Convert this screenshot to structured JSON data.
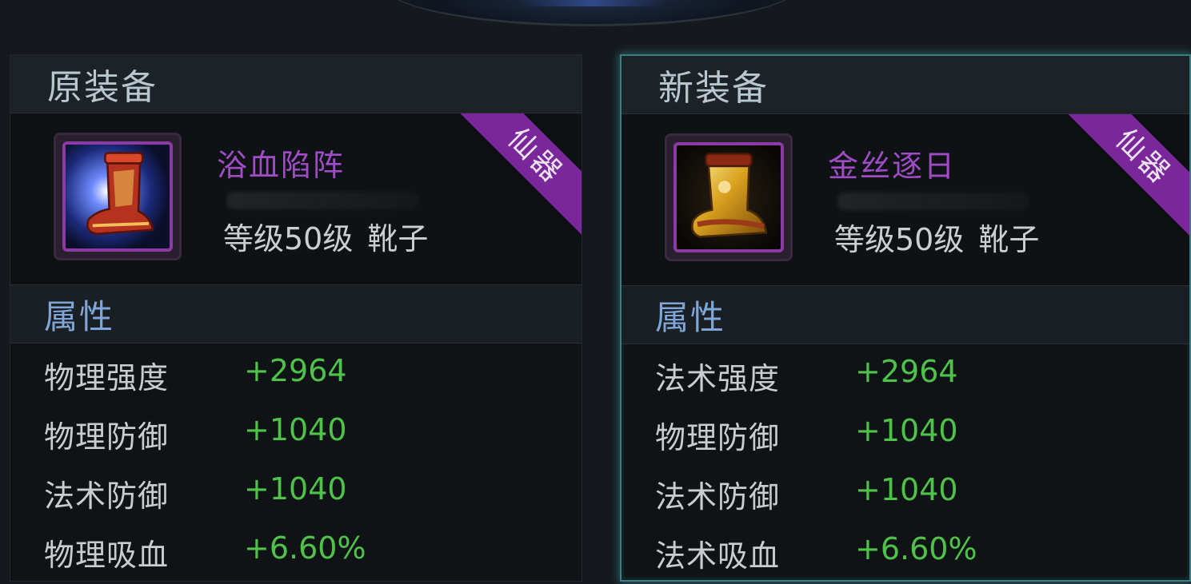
{
  "panels": {
    "old": {
      "title": "原装备",
      "item": {
        "name": "浴血陷阵",
        "level": "等级50级",
        "slot": "靴子",
        "grade": "仙器",
        "icon": "red-boot-icon"
      },
      "attr_title": "属性",
      "stats": [
        {
          "name": "物理强度",
          "value": "+2964"
        },
        {
          "name": "物理防御",
          "value": "+1040"
        },
        {
          "name": "法术防御",
          "value": "+1040"
        },
        {
          "name": "物理吸血",
          "value": "+6.60%"
        }
      ]
    },
    "new": {
      "title": "新装备",
      "item": {
        "name": "金丝逐日",
        "level": "等级50级",
        "slot": "靴子",
        "grade": "仙器",
        "icon": "gold-boot-icon"
      },
      "attr_title": "属性",
      "stats": [
        {
          "name": "法术强度",
          "value": "+2964"
        },
        {
          "name": "物理防御",
          "value": "+1040"
        },
        {
          "name": "法术防御",
          "value": "+1040"
        },
        {
          "name": "法术吸血",
          "value": "+6.60%"
        }
      ]
    }
  },
  "colors": {
    "item_name": "#a04cc7",
    "stat_value": "#4fc24a",
    "attr_title": "#7fa6d8",
    "ribbon": "#7a279b",
    "selected_border": "#3a7f86"
  }
}
